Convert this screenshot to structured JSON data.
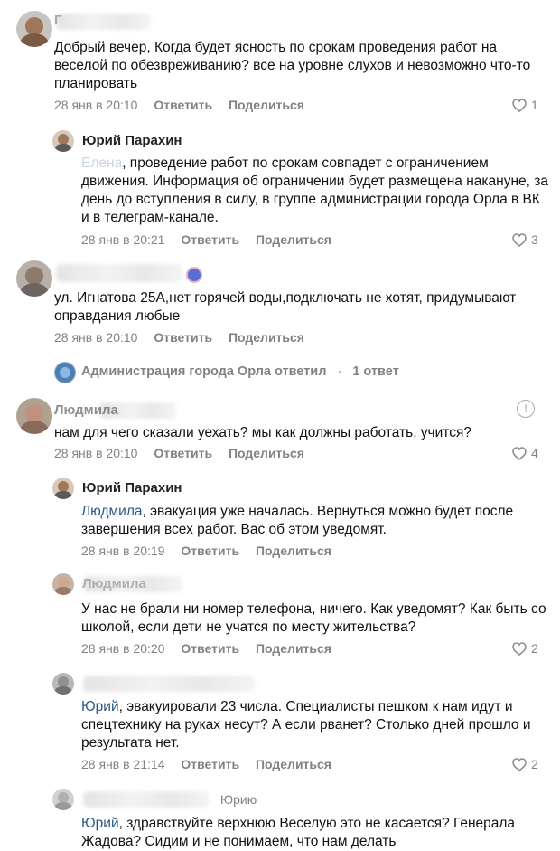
{
  "comments": [
    {
      "author": "Г",
      "text": "Добрый вечер, Когда будет ясность по срокам проведения работ на веселой по обезвреживанию? все на уровне слухов и невозможно что-то планировать",
      "date": "28 янв в 20:10",
      "reply": "Ответить",
      "share": "Поделиться",
      "likes": "1"
    },
    {
      "author": "Юрий Парахин",
      "mention": "Елена",
      "text": ", проведение работ по срокам совпадет с ограничением движения. Информация об ограничении будет размещена накануне, за день до вступления в силу, в группе администрации города Орла в ВК и в телеграм-канале.",
      "date": "28 янв в 20:21",
      "reply": "Ответить",
      "share": "Поделиться",
      "likes": "3"
    },
    {
      "author": "",
      "text": "ул. Игнатова 25А,нет горячей воды,подключать не хотят, придумывают оправдания любые",
      "date": "28 янв в 20:10",
      "reply": "Ответить",
      "share": "Поделиться"
    },
    {
      "author": "Людмила",
      "text": "нам для чего сказали уехать? мы как должны работать, учится?",
      "date": "28 янв в 20:10",
      "reply": "Ответить",
      "share": "Поделиться",
      "likes": "4"
    },
    {
      "author": "Юрий Парахин",
      "mention": "Людмила",
      "text": ", эвакуация уже началась. Вернуться можно будет после завершения всех работ. Вас об этом уведомят.",
      "date": "28 янв в 20:19",
      "reply": "Ответить",
      "share": "Поделиться"
    },
    {
      "author": "Людмила",
      "text": "У нас не брали ни номер телефона, ничего. Как уведомят? Как быть со школой, если дети не учатся по месту жительства?",
      "date": "28 янв в 20:20",
      "reply": "Ответить",
      "share": "Поделиться",
      "likes": "2"
    },
    {
      "author": "",
      "mention": "Юрий",
      "text": ", эвакуировали 23 числа. Специалисты пешком к нам идут и спецтехнику на руках несут? А если рванет? Столько дней прошло и результата нет.",
      "date": "28 янв в 21:14",
      "reply": "Ответить",
      "share": "Поделиться",
      "likes": "2"
    },
    {
      "author": "",
      "reply_to": "Юрию",
      "mention": "Юрий",
      "text": ", здравствуйте верхнюю Веселую это не касается? Генерала Жадова? Сидим и не понимаем, что нам делать"
    }
  ],
  "thread": {
    "label": "Администрация города Орла ответил",
    "count": "1 ответ"
  },
  "icons": {
    "like": "heart-outline-icon",
    "more": "exclamation-circle-icon"
  },
  "colors": {
    "link": "#2a5885",
    "meta": "#828282"
  }
}
